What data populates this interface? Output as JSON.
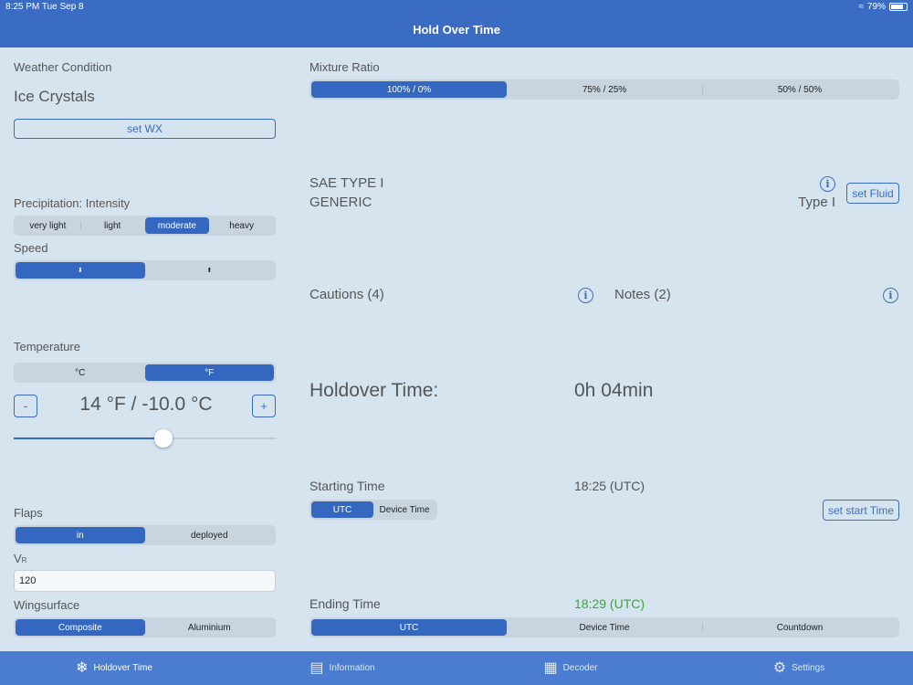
{
  "status": {
    "time": "8:25 PM   Tue Sep 8",
    "battery": "79%",
    "battery_level": 0.79
  },
  "nav": {
    "title": "Hold Over Time"
  },
  "weather": {
    "label": "Weather Condition",
    "value": "Ice Crystals",
    "button": "set WX"
  },
  "precip": {
    "label": "Precipitation: Intensity",
    "options": [
      "very light",
      "light",
      "moderate",
      "heavy"
    ],
    "selected": "moderate"
  },
  "speed": {
    "label": "Speed",
    "options": [
      "⬇",
      "⬆"
    ],
    "selected_index": 0
  },
  "temperature": {
    "label": "Temperature",
    "units": [
      "°C",
      "°F"
    ],
    "selected_unit": "°F",
    "minus": "-",
    "plus": "+",
    "value": "14 °F / -10.0 °C",
    "slider_fraction": 0.57
  },
  "flaps": {
    "label": "Flaps",
    "options": [
      "in",
      "deployed"
    ],
    "selected": "in"
  },
  "vr": {
    "label_main": "V",
    "label_sub": "R",
    "value": "120"
  },
  "wing": {
    "label": "Wingsurface",
    "options": [
      "Composite",
      "Aluminium"
    ],
    "selected": "Composite"
  },
  "mixture": {
    "label": "Mixture Ratio",
    "options": [
      "100% / 0%",
      "75% / 25%",
      "50% / 50%"
    ],
    "selected": "100% / 0%"
  },
  "fluid": {
    "line1": "SAE TYPE I",
    "line2": "GENERIC",
    "type": "Type I",
    "button": "set Fluid",
    "info_icon": "i"
  },
  "cautions": {
    "label": "Cautions (4)",
    "info_icon": "i"
  },
  "notes": {
    "label": "Notes (2)",
    "info_icon": "i"
  },
  "holdover": {
    "label": "Holdover Time:",
    "value": "0h 04min"
  },
  "start": {
    "label": "Starting Time",
    "value": "18:25 (UTC)",
    "options": [
      "UTC",
      "Device Time"
    ],
    "selected": "UTC",
    "button": "set start Time"
  },
  "end": {
    "label": "Ending Time",
    "value": "18:29 (UTC)",
    "value_color": "#3aa63a",
    "options": [
      "UTC",
      "Device Time",
      "Countdown"
    ],
    "selected": "UTC"
  },
  "tabs": [
    {
      "label": "Holdover Time",
      "icon": "snowflake-icon",
      "glyph": "❄"
    },
    {
      "label": "Information",
      "icon": "book-icon",
      "glyph": "▤"
    },
    {
      "label": "Decoder",
      "icon": "decoder-icon",
      "glyph": "▦"
    },
    {
      "label": "Settings",
      "icon": "gear-icon",
      "glyph": "⚙"
    }
  ]
}
